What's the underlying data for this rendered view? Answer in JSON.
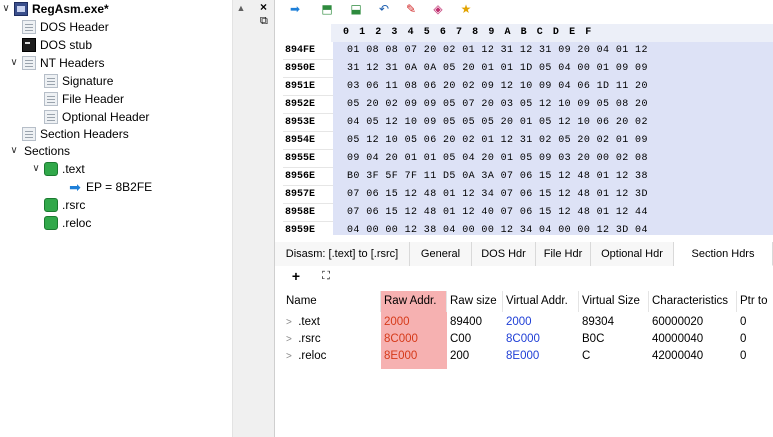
{
  "tree": {
    "root": "RegAsm.exe*",
    "items": [
      {
        "label": "DOS Header"
      },
      {
        "label": "DOS stub"
      },
      {
        "label": "NT Headers"
      },
      {
        "label": "Signature"
      },
      {
        "label": "File Header"
      },
      {
        "label": "Optional Header"
      },
      {
        "label": "Section Headers"
      },
      {
        "label": "Sections"
      },
      {
        "label": ".text"
      },
      {
        "label": "EP = 8B2FE"
      },
      {
        "label": ".rsrc"
      },
      {
        "label": ".reloc"
      }
    ]
  },
  "hex": {
    "columns": [
      "0",
      "1",
      "2",
      "3",
      "4",
      "5",
      "6",
      "7",
      "8",
      "9",
      "A",
      "B",
      "C",
      "D",
      "E",
      "F"
    ],
    "rows": [
      {
        "addr": "894FE",
        "bytes": "01 08 08 07 20 02 01 12 31 12 31 09 20 04 01 12"
      },
      {
        "addr": "8950E",
        "bytes": "31 12 31 0A 0A 05 20 01 01 1D 05 04 00 01 09 09"
      },
      {
        "addr": "8951E",
        "bytes": "03 06 11 08 06 20 02 09 12 10 09 04 06 1D 11 20"
      },
      {
        "addr": "8952E",
        "bytes": "05 20 02 09 09 05 07 20 03 05 12 10 09 05 08 20"
      },
      {
        "addr": "8953E",
        "bytes": "04 05 12 10 09 05 05 05 20 01 05 12 10 06 20 02"
      },
      {
        "addr": "8954E",
        "bytes": "05 12 10 05 06 20 02 01 12 31 02 05 20 02 01 09"
      },
      {
        "addr": "8955E",
        "bytes": "09 04 20 01 01 05 04 20 01 05 09 03 20 00 02 08"
      },
      {
        "addr": "8956E",
        "bytes": "B0 3F 5F 7F 11 D5 0A 3A 07 06 15 12 48 01 12 38"
      },
      {
        "addr": "8957E",
        "bytes": "07 06 15 12 48 01 12 34 07 06 15 12 48 01 12 3D"
      },
      {
        "addr": "8958E",
        "bytes": "07 06 15 12 48 01 12 40 07 06 15 12 48 01 12 44"
      },
      {
        "addr": "8959E",
        "bytes": "04 00 00 12 38 04 00 00 12 34 04 00 00 12 3D 04"
      }
    ]
  },
  "tabs": [
    {
      "label": "Disasm: [.text] to [.rsrc]"
    },
    {
      "label": "General"
    },
    {
      "label": "DOS Hdr"
    },
    {
      "label": "File Hdr"
    },
    {
      "label": "Optional Hdr"
    },
    {
      "label": "Section Hdrs"
    }
  ],
  "sub_toolbar": {
    "add": "+",
    "resize": "⛶"
  },
  "table": {
    "headers": [
      "Name",
      "Raw Addr.",
      "Raw size",
      "Virtual Addr.",
      "Virtual Size",
      "Characteristics",
      "Ptr to"
    ],
    "rows": [
      {
        "name": ".text",
        "raw_addr": "2000",
        "raw_size": "89400",
        "virt_addr": "2000",
        "virt_size": "89304",
        "chars": "60000020",
        "ptr": "0"
      },
      {
        "name": ".rsrc",
        "raw_addr": "8C000",
        "raw_size": "C00",
        "virt_addr": "8C000",
        "virt_size": "B0C",
        "chars": "40000040",
        "ptr": "0"
      },
      {
        "name": ".reloc",
        "raw_addr": "8E000",
        "raw_size": "200",
        "virt_addr": "8E000",
        "virt_size": "C",
        "chars": "42000040",
        "ptr": "0"
      }
    ]
  },
  "colors": {
    "highlight": "#f6b1b1",
    "hex_bg": "#dde2f6",
    "link_blue": "#1f3fd6",
    "raw_red": "#d63a1a"
  }
}
